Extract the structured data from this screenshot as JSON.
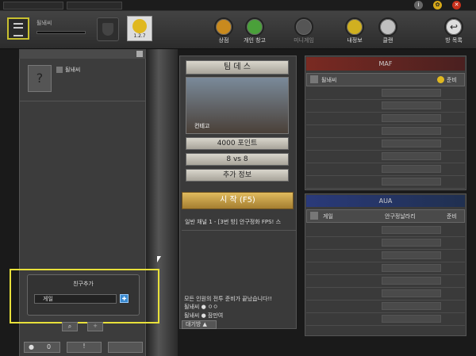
{
  "topbar": {
    "nickname": "될놰씨",
    "rank_badge_text": "1.2.7",
    "nav": [
      {
        "label": "상점",
        "color": "#c98a1e"
      },
      {
        "label": "개인 창고",
        "color": "#4aa03a"
      },
      {
        "label": "미니게임",
        "color": "#555555"
      },
      {
        "label": "내정보",
        "color": "#d0b020"
      },
      {
        "label": "클랜",
        "color": "#c0c0c0"
      }
    ],
    "back_label": "방 목록"
  },
  "left": {
    "friend_name": "될놰씨",
    "popup": {
      "title": "친구추가",
      "input_value": "게일"
    },
    "bottom": {
      "friend_count": "0",
      "alert": "!"
    }
  },
  "center": {
    "mode": "팀 데 스",
    "map_name": "컨테고",
    "points": "4000 포인트",
    "players": "8 vs 8",
    "extra": "추가 정보",
    "start": "시 작 (F5)",
    "room_info": "일반 채널 1 - [3번 방] 안구정화 FPS! 스",
    "chat": {
      "system": "모든 인원의 전투 준비가 끝났습니다!!",
      "lines": [
        {
          "name": "될놰씨",
          "text": "ㅇㅇ"
        },
        {
          "name": "될놰씨",
          "text": "잠만여"
        }
      ]
    },
    "chat_tab": "대기방"
  },
  "team_a": {
    "name": "MAF",
    "color": "#7a2a22",
    "player": "될놰씨",
    "ready": "준비",
    "empty_rows": 8
  },
  "team_b": {
    "name": "AUA",
    "color": "#2a3a7a",
    "player": "게일",
    "player_detail": "안구정날라리",
    "ready": "준비",
    "empty_rows": 8
  },
  "colors": {
    "highlight": "#e8e03a",
    "start_btn": "#c7a046"
  }
}
